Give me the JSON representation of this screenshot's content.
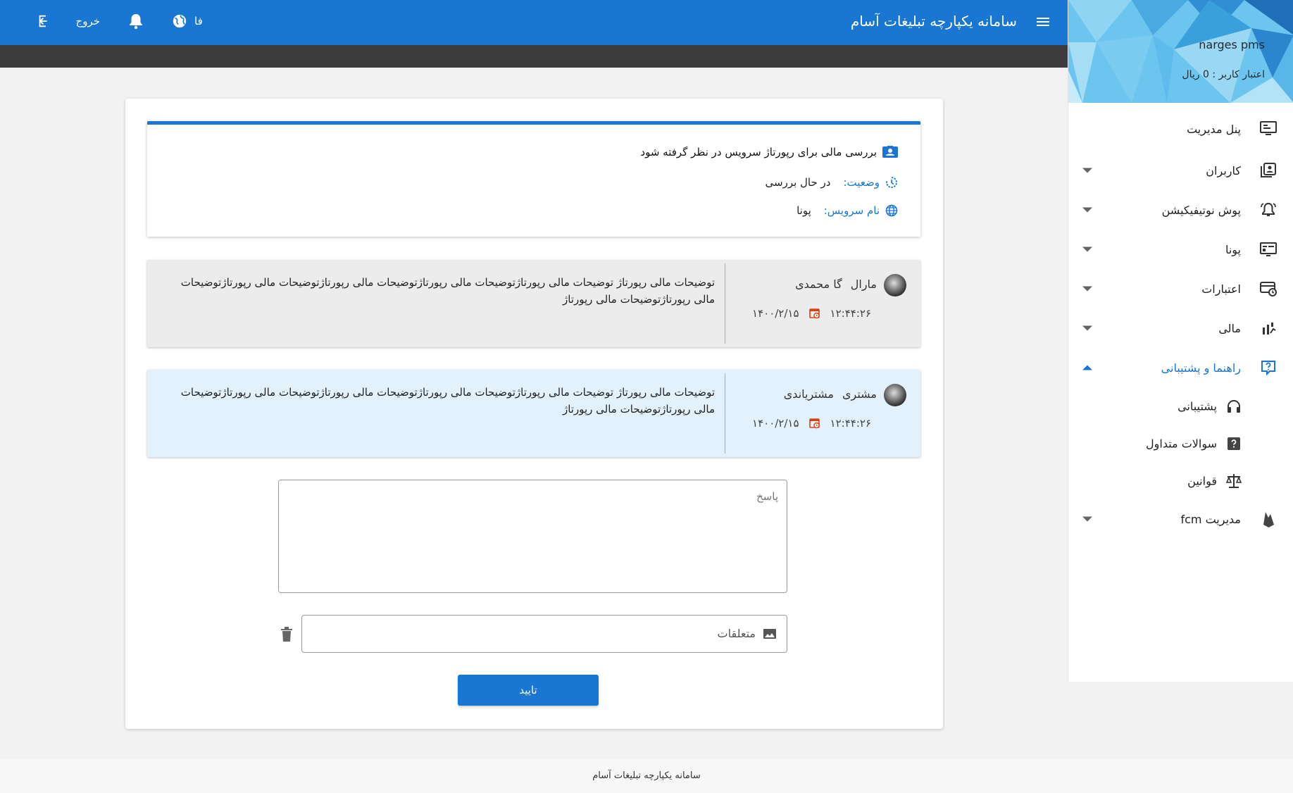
{
  "header": {
    "title": "سامانه یکپارچه تبلیغات آسام",
    "logout_label": "خروج",
    "language_label": "فا"
  },
  "user": {
    "name": "narges pms",
    "credit": "اعتبار کاربر : 0 ریال"
  },
  "sidebar": {
    "items": [
      {
        "label": "پنل مدیریت",
        "icon": "dashboard-icon",
        "has_arrow": false
      },
      {
        "label": "کاربران",
        "icon": "users-icon",
        "has_arrow": true
      },
      {
        "label": "پوش نوتیفیکیشن",
        "icon": "bell-icon",
        "has_arrow": true
      },
      {
        "label": "پونا",
        "icon": "card-icon",
        "has_arrow": true
      },
      {
        "label": "اعتبارات",
        "icon": "credit-icon",
        "has_arrow": true
      },
      {
        "label": "مالی",
        "icon": "chart-icon",
        "has_arrow": true
      },
      {
        "label": "راهنما و پشتیبانی",
        "icon": "help-icon",
        "has_arrow": true,
        "active": true
      },
      {
        "label": "مدیریت fcm",
        "icon": "firebase-icon",
        "has_arrow": true
      }
    ],
    "submenu": [
      {
        "label": "پشتیبانی",
        "icon": "headset-icon"
      },
      {
        "label": "سوالات متداول",
        "icon": "question-icon"
      },
      {
        "label": "قوانین",
        "icon": "scale-icon"
      }
    ],
    "accent_color": "#1976d2"
  },
  "ticket": {
    "title": "بررسی مالی برای رپورتاژ سرویس در نظر گرفته شود",
    "status_key": "وضعیت:",
    "status_value": "در حال بررسی",
    "service_key": "نام سرویس:",
    "service_value": "پونا"
  },
  "messages": [
    {
      "sender_name": "مارال",
      "sender_family": "گا محمدی",
      "time": "۱۲:۴۴:۲۶",
      "date": "۱۴۰۰/۲/۱۵",
      "body": "توضیحات مالی رپورتاژ توضیحات مالی رپورتاژتوضیحات مالی رپورتاژتوضیحات مالی رپورتاژتوضیحات مالی رپورتاژتوضیحات مالی رپورتاژتوضیحات مالی رپورتاژ"
    },
    {
      "sender_name": "مشتری",
      "sender_family": "مشتریاندی",
      "time": "۱۲:۴۴:۲۶",
      "date": "۱۴۰۰/۲/۱۵",
      "body": "توضیحات مالی رپورتاژ توضیحات مالی رپورتاژتوضیحات مالی رپورتاژتوضیحات مالی رپورتاژتوضیحات مالی رپورتاژتوضیحات مالی رپورتاژتوضیحات مالی رپورتاژ"
    }
  ],
  "form": {
    "reply_placeholder": "پاسخ",
    "attachments_label": "متعلقات",
    "submit_label": "تایید"
  },
  "footer": {
    "text": "سامانه یکپارچه تبلیغات آسام"
  }
}
